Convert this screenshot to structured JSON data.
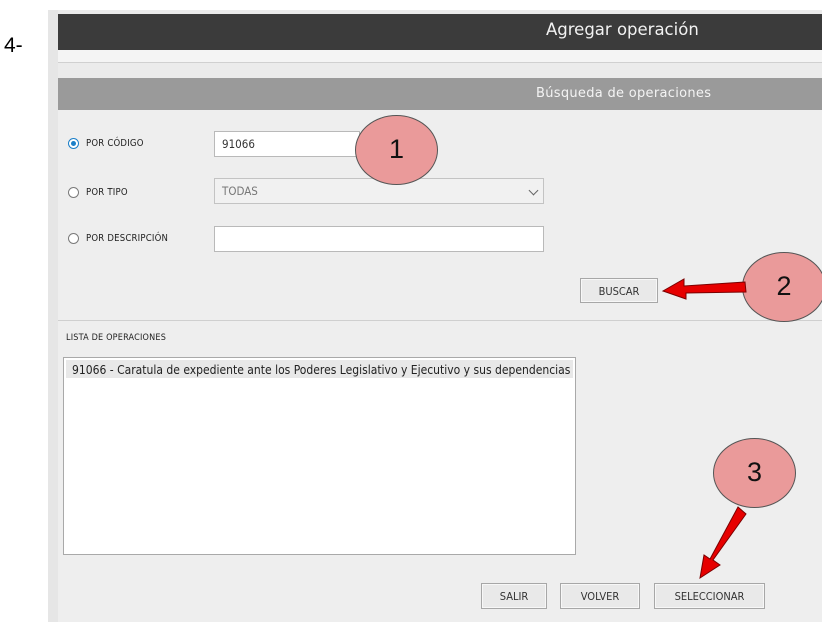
{
  "step_label": "4-",
  "window": {
    "title": "Agregar operación"
  },
  "search": {
    "section_title": "Búsqueda de operaciones",
    "options": [
      {
        "label": "POR CÓDIGO",
        "selected": true,
        "value": "91066"
      },
      {
        "label": "POR TIPO",
        "selected": false,
        "value": "TODAS"
      },
      {
        "label": "POR DESCRIPCIÓN",
        "selected": false,
        "value": ""
      }
    ],
    "search_button": "BUSCAR"
  },
  "operations_list": {
    "header": "LISTA DE OPERACIONES",
    "items": [
      "91066 - Caratula de expediente ante los Poderes Legislativo y Ejecutivo y sus dependencias"
    ]
  },
  "footer_buttons": {
    "exit": "SALIR",
    "back": "VOLVER",
    "select": "SELECCIONAR"
  },
  "annotations": {
    "callouts": [
      "1",
      "2",
      "3"
    ],
    "fill_color": "#ea9a9a",
    "arrow_color": "#e60000"
  },
  "colors": {
    "titlebar": "#3b3b3b",
    "subbar": "#9a9a9a",
    "panel": "#eeeeee",
    "radio_selected": "#1b7fc8"
  }
}
